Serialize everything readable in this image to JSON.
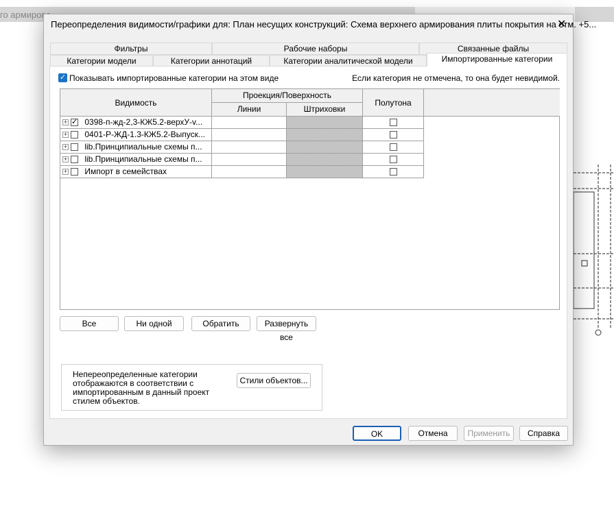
{
  "background": {
    "doc_tab_text": "го армирова"
  },
  "dialog": {
    "title": "Переопределения видимости/графики для: План несущих конструкций: Схема верхнего армирования плиты покрытия на отм. +5...",
    "close_icon": "close-icon",
    "tabs_row1": [
      "Фильтры",
      "Рабочие наборы",
      "Связанные файлы"
    ],
    "tabs_row2": [
      "Категории модели",
      "Категории аннотаций",
      "Категории аналитической модели",
      "Импортированные категории"
    ],
    "active_tab": "Импортированные категории",
    "show_imported_label": "Показывать импортированные категории на этом виде",
    "show_imported_checked": true,
    "hint": "Если категория не отмечена, то она будет невидимой.",
    "grid": {
      "headers": {
        "visibility": "Видимость",
        "projection": "Проекция/Поверхность",
        "lines": "Линии",
        "hatch": "Штриховки",
        "halftone": "Полутона"
      },
      "rows": [
        {
          "name": "0398-п-жд-2,3-КЖ5.2-верхУ-v...",
          "visible": true,
          "halftone": false
        },
        {
          "name": "0401-Р-ЖД-1.3-КЖ5.2-Выпуск...",
          "visible": false,
          "halftone": false
        },
        {
          "name": "lib.Принципиальные схемы п...",
          "visible": false,
          "halftone": false
        },
        {
          "name": "lib.Принципиальные схемы п...",
          "visible": false,
          "halftone": false
        },
        {
          "name": "Импорт в семействах",
          "visible": false,
          "halftone": false
        }
      ]
    },
    "buttons": {
      "all": "Все",
      "none": "Ни одной",
      "invert": "Обратить",
      "expand_all": "Развернуть все"
    },
    "group_text": "Непереопределенные категории отображаются в соответствии с импортированным в данный проект стилем объектов.",
    "object_styles": "Стили объектов...",
    "footer": {
      "ok": "OK",
      "cancel": "Отмена",
      "apply": "Применить",
      "help": "Справка"
    }
  }
}
